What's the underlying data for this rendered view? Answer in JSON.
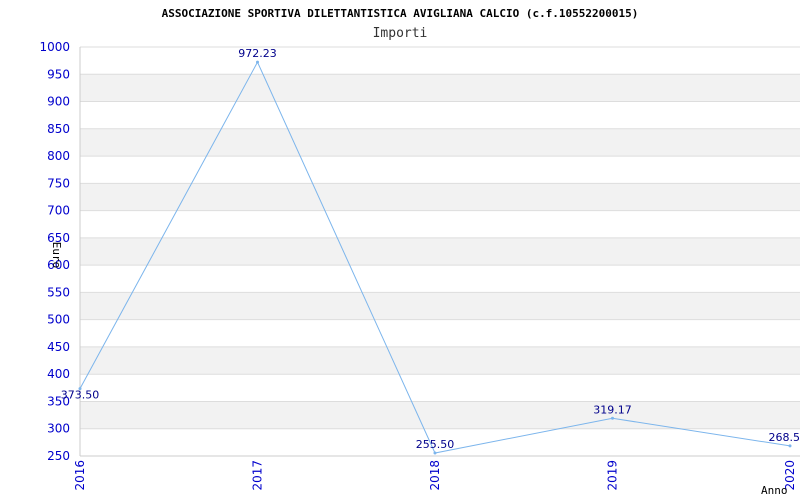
{
  "chart_data": {
    "type": "line",
    "title": "ASSOCIAZIONE SPORTIVA DILETTANTISTICA AVIGLIANA CALCIO (c.f.10552200015)",
    "subtitle": "Importi",
    "xlabel": "Anno",
    "ylabel": "Euro",
    "categories": [
      "2016",
      "2017",
      "2018",
      "2019",
      "2020"
    ],
    "values": [
      373.5,
      972.23,
      255.5,
      319.17,
      268.5
    ],
    "data_labels": [
      "373.50",
      "972.23",
      "255.50",
      "319.17",
      "268.5"
    ],
    "ylim": [
      250,
      1000
    ],
    "yticks": [
      250,
      300,
      350,
      400,
      450,
      500,
      550,
      600,
      650,
      700,
      750,
      800,
      850,
      900,
      950,
      1000
    ],
    "grid": "horizontal alternating bands",
    "colors": {
      "line": "#7cb5ec",
      "label": "#00008b",
      "tick": "#0000cc",
      "band": "#f2f2f2",
      "grid": "#dddddd"
    }
  }
}
